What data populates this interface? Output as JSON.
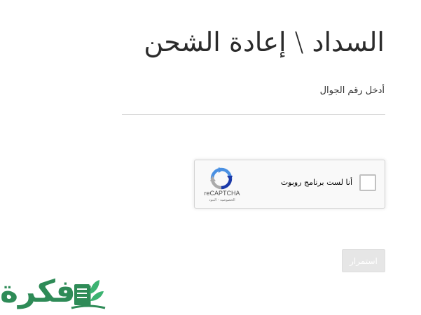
{
  "page": {
    "title": "السداد \\ إعادة الشحن"
  },
  "form": {
    "phone_label": "أدخل رقم الجوال",
    "phone_value": ""
  },
  "recaptcha": {
    "label": "أنا لست برنامج روبوت",
    "brand": "reCAPTCHA",
    "links": "الخصوصية - البنود"
  },
  "actions": {
    "continue_label": "استمرار"
  },
  "watermark": {
    "text": "فكرة"
  },
  "colors": {
    "brand_green": "#2e8b57",
    "disabled_button": "#e6e6e6"
  }
}
